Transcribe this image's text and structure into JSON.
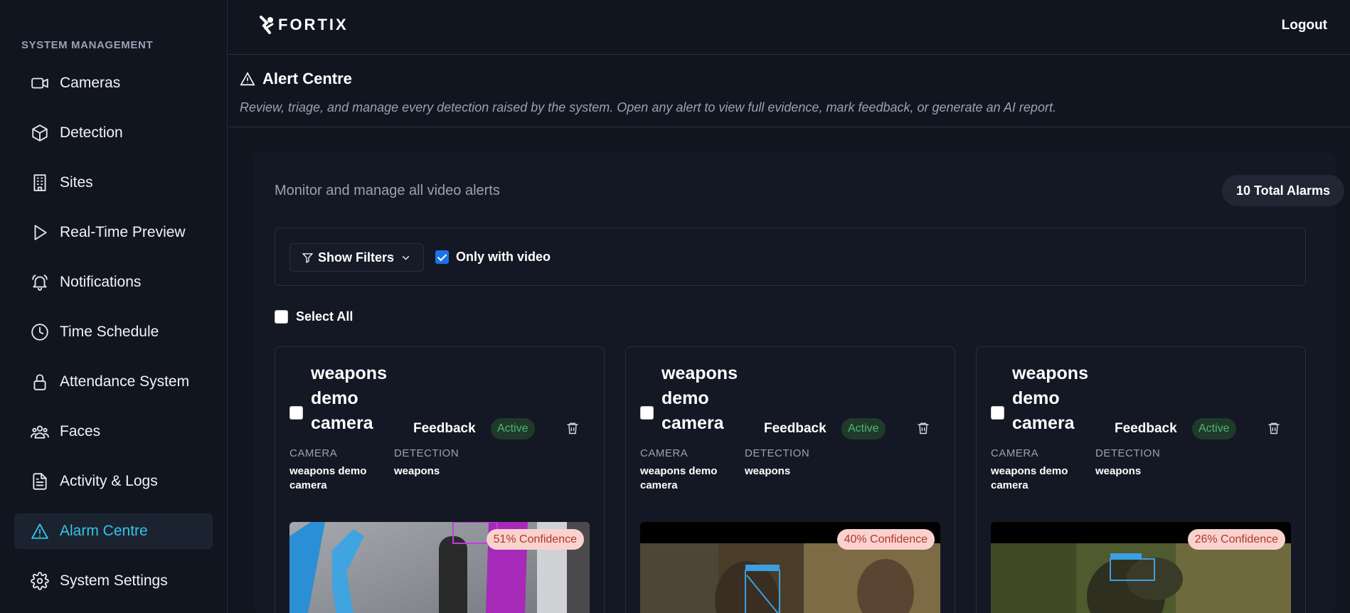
{
  "app": {
    "logo_text": "FORTIX",
    "logout_label": "Logout"
  },
  "sidebar": {
    "heading": "SYSTEM MANAGEMENT",
    "items": [
      {
        "label": "Cameras",
        "icon": "video-camera-icon"
      },
      {
        "label": "Detection",
        "icon": "box-icon"
      },
      {
        "label": "Sites",
        "icon": "building-icon"
      },
      {
        "label": "Real-Time Preview",
        "icon": "play-icon"
      },
      {
        "label": "Notifications",
        "icon": "bell-icon"
      },
      {
        "label": "Time Schedule",
        "icon": "clock-icon"
      },
      {
        "label": "Attendance System",
        "icon": "lock-icon"
      },
      {
        "label": "Faces",
        "icon": "users-icon"
      },
      {
        "label": "Activity & Logs",
        "icon": "file-text-icon"
      },
      {
        "label": "Alarm Centre",
        "icon": "alert-triangle-icon",
        "active": true
      },
      {
        "label": "System Settings",
        "icon": "gear-icon"
      }
    ]
  },
  "page": {
    "title": "Alert Centre",
    "subtitle": "Review, triage, and manage every detection raised by the system. Open any alert to view full evidence, mark feedback, or generate an AI report."
  },
  "alarms": {
    "monitor_text": "Monitor and manage all video alerts",
    "total_label": "10 Total Alarms",
    "show_filters_label": "Show Filters",
    "only_with_video_label": "Only with video",
    "only_with_video_checked": true,
    "select_all_label": "Select All",
    "meta_labels": {
      "camera": "CAMERA",
      "detection": "DETECTION"
    },
    "feedback_label": "Feedback",
    "cards": [
      {
        "title": "weapons demo camera",
        "status": "Active",
        "camera": "weapons demo camera",
        "detection": "weapons",
        "confidence": "51% Confidence"
      },
      {
        "title": "weapons demo camera",
        "status": "Active",
        "camera": "weapons demo camera",
        "detection": "weapons",
        "confidence": "40% Confidence"
      },
      {
        "title": "weapons demo camera",
        "status": "Active",
        "camera": "weapons demo camera",
        "detection": "weapons",
        "confidence": "26% Confidence"
      }
    ]
  },
  "colors": {
    "accent": "#35c5ea",
    "active_badge_bg": "#1f3a2a",
    "active_badge_text": "#4fb477",
    "confidence_bg": "#f9d2cf",
    "confidence_text": "#b3362a",
    "checkbox": "#1a73e8"
  }
}
